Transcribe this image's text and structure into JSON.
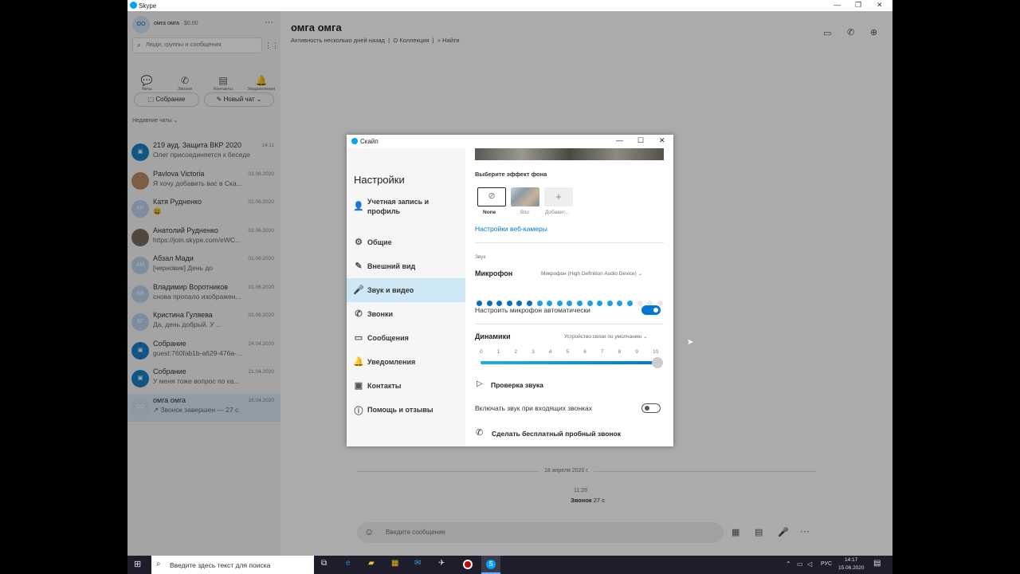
{
  "window": {
    "title": "Skype",
    "minimize": "—",
    "maximize": "❐",
    "close": "✕"
  },
  "profile": {
    "name": "омга омга",
    "balance": "$0.00",
    "more": "···",
    "initials": "ОО"
  },
  "search": {
    "placeholder": "Люди, группы и сообщения",
    "grid_icon": "⋮⋮"
  },
  "nav": [
    {
      "label": "Чаты",
      "glyph": "💬"
    },
    {
      "label": "Звонки",
      "glyph": "✆"
    },
    {
      "label": "Контакты",
      "glyph": "▤"
    },
    {
      "label": "Уведомления",
      "glyph": "🔔"
    }
  ],
  "actions": {
    "meeting": "Собрание",
    "new_chat": "Новый чат"
  },
  "recent_label": "Недавние чаты",
  "chats": [
    {
      "name": "219 ауд. Защита ВКР 2020",
      "preview": "Олег присоединяется к беседе",
      "date": "14:11",
      "initials": "▣",
      "color": "#1a7fc7"
    },
    {
      "name": "Pavlova Victoria",
      "preview": "Я хочу добавить вас в Ска...",
      "date": "03.06.2020",
      "initials": "",
      "color": "#b98b68"
    },
    {
      "name": "Катя Рудненко",
      "preview": "😀",
      "date": "02.06.2020",
      "initials": "КР",
      "color": "#bcd3ea"
    },
    {
      "name": "Анатолий Рудненко",
      "preview": "https://join.skype.com/eWC...",
      "date": "02.06.2020",
      "initials": "",
      "color": "#7a6a5a"
    },
    {
      "name": "Абзал Мади",
      "preview": "[черновик] День до",
      "date": "01.06.2020",
      "initials": "АМ",
      "color": "#bcd3ea"
    },
    {
      "name": "Владимир Воротников",
      "preview": "снова пропало изображен...",
      "date": "01.06.2020",
      "initials": "ВВ",
      "color": "#bcd3ea"
    },
    {
      "name": "Кристина Гуляева",
      "preview": "Да, день добрый. У ...",
      "date": "01.06.2020",
      "initials": "КГ",
      "color": "#bcd3ea"
    },
    {
      "name": "Собрание",
      "preview": "guest:760fab1b-a629-476a-...",
      "date": "24.04.2020",
      "initials": "▣",
      "color": "#1a7fc7"
    },
    {
      "name": "Собрание",
      "preview": "У меня тоже вопрос по ка...",
      "date": "21.04.2020",
      "initials": "▣",
      "color": "#1a7fc7"
    },
    {
      "name": "омга омга",
      "preview": "↗ Звонок завершен — 27 с",
      "date": "18.04.2020",
      "initials": "ОО",
      "color": "#cfe3f3"
    }
  ],
  "conversation": {
    "title": "омга омга",
    "subtitle": "Активность несколько дней назад",
    "gallery": "Коллекция",
    "find": "Найти",
    "date_label": "18 апреля 2020 г.",
    "time": "11:28",
    "call_label": "Звонок",
    "call_duration": "27 с",
    "message_placeholder": "Введите сообщение"
  },
  "dialog": {
    "title": "Скайп",
    "heading": "Настройки"
  },
  "settings_nav": [
    {
      "label": "Учетная запись и",
      "label2": "профиль",
      "icon": "👤"
    },
    {
      "label": "Общие",
      "icon": "⚙"
    },
    {
      "label": "Внешний вид",
      "icon": "✎"
    },
    {
      "label": "Звук и видео",
      "icon": "🎤",
      "active": true
    },
    {
      "label": "Звонки",
      "icon": "✆"
    },
    {
      "label": "Сообщения",
      "icon": "▭"
    },
    {
      "label": "Уведомления",
      "icon": "🔔"
    },
    {
      "label": "Контакты",
      "icon": "▣"
    },
    {
      "label": "Помощь и отзывы",
      "icon": "ⓘ"
    }
  ],
  "settings": {
    "bg_effect_label": "Выберите эффект фона",
    "effects": [
      {
        "label": "None",
        "glyph": "⊘"
      },
      {
        "label": "Blur",
        "glyph": ""
      },
      {
        "label": "Добавит...",
        "glyph": "+"
      }
    ],
    "webcam_link": "Настройки веб-камеры",
    "audio_section": "Звук",
    "mic_label": "Микрофон",
    "mic_device": "Микрофон (High Definition Audio Device)",
    "mic_level_active": 16,
    "mic_level_total": 19,
    "auto_mic_label": "Настроить микрофон автоматически",
    "auto_mic_on": true,
    "speaker_label": "Динамики",
    "speaker_device": "Устройство связи по умолчанию",
    "scale": [
      "0",
      "1",
      "2",
      "3",
      "4",
      "5",
      "6",
      "7",
      "8",
      "9",
      "10"
    ],
    "speaker_volume": 10,
    "sound_test": "Проверка звука",
    "ring_label": "Включать звук при входящих звонках",
    "ring_on": false,
    "test_call": "Сделать бесплатный пробный звонок"
  },
  "taskbar": {
    "search_placeholder": "Введите здесь текст для поиска",
    "lang": "РУС",
    "time": "14:17",
    "date": "15.06.2020"
  },
  "colors": {
    "accent": "#0078d4",
    "active_nav": "#cfe8f6"
  }
}
